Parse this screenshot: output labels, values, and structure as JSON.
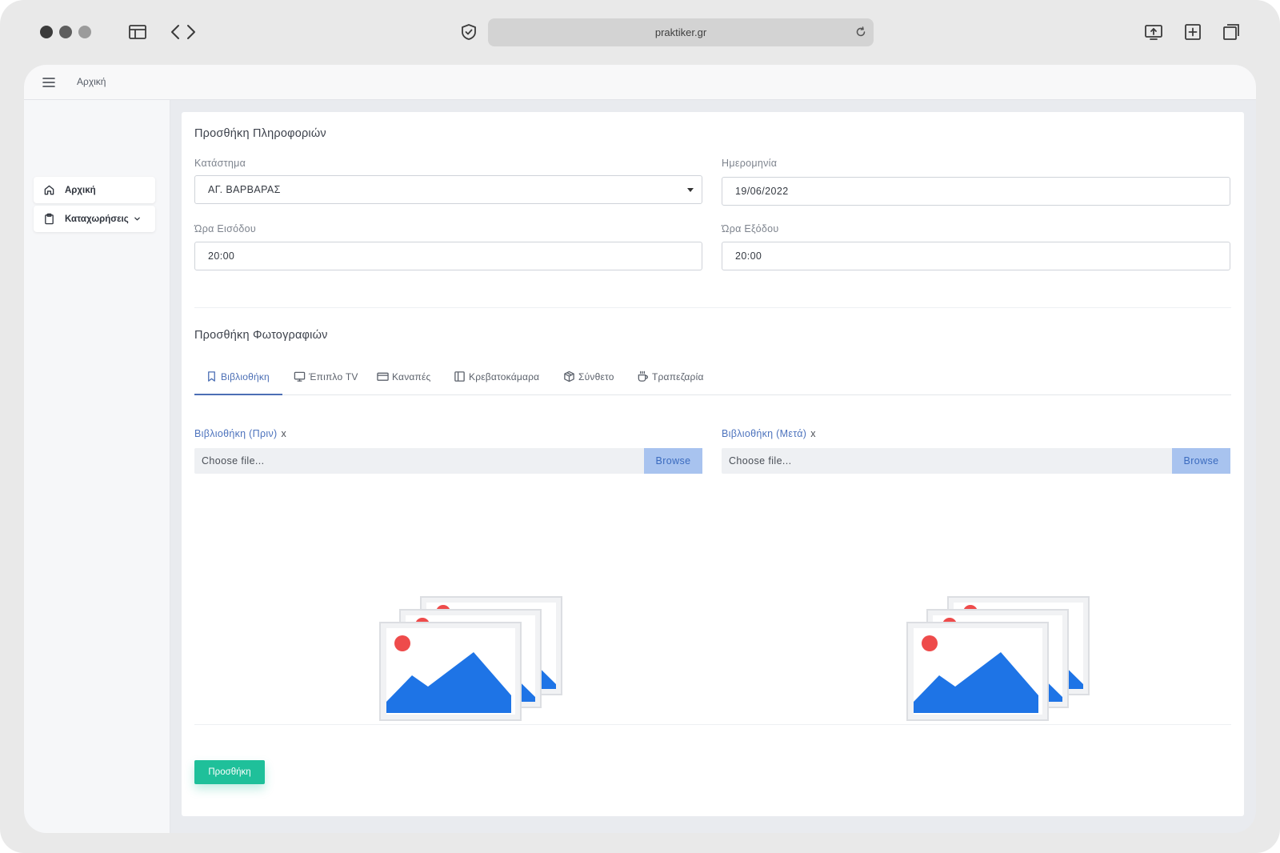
{
  "browser": {
    "url": "praktiker.gr"
  },
  "topbar": {
    "title": "Αρχική"
  },
  "sidebar": {
    "items": [
      {
        "label": "Αρχική",
        "icon": "home-icon"
      },
      {
        "label": "Καταχωρήσεις",
        "icon": "clipboard-icon"
      }
    ]
  },
  "info_section": {
    "title": "Προσθήκη Πληροφοριών",
    "store": {
      "label": "Κατάστημα",
      "value": "ΑΓ. ΒΑΡΒΑΡΑΣ"
    },
    "date": {
      "label": "Ημερομηνία",
      "value": "19/06/2022"
    },
    "entry_time": {
      "label": "Ώρα Εισόδου",
      "value": "20:00"
    },
    "exit_time": {
      "label": "Ώρα Εξόδου",
      "value": "20:00"
    }
  },
  "photos_section": {
    "title": "Προσθήκη Φωτογραφιών",
    "tabs": [
      {
        "label": "Βιβλιοθήκη",
        "icon": "bookmark-icon",
        "active": true
      },
      {
        "label": "Έπιπλο TV",
        "icon": "monitor-icon",
        "active": false
      },
      {
        "label": "Καναπές",
        "icon": "card-icon",
        "active": false
      },
      {
        "label": "Κρεβατοκάμαρα",
        "icon": "sidebar-layout-icon",
        "active": false
      },
      {
        "label": "Σύνθετο",
        "icon": "package-icon",
        "active": false
      },
      {
        "label": "Τραπεζαρία",
        "icon": "coffee-cup-icon",
        "active": false
      }
    ],
    "uploads": [
      {
        "label": "Βιβλιοθήκη (Πριν)",
        "remove": "x",
        "placeholder": "Choose file...",
        "button": "Browse"
      },
      {
        "label": "Βιβλιοθήκη (Μετά)",
        "remove": "x",
        "placeholder": "Choose file...",
        "button": "Browse"
      }
    ]
  },
  "actions": {
    "submit_label": "Προσθήκη"
  },
  "colors": {
    "accent_blue": "#4c6fb5",
    "browse_bg": "#a8c3ef",
    "submit_green": "#1fc09a",
    "image_blue": "#1e74e6",
    "image_sun": "#ee4b4b"
  }
}
